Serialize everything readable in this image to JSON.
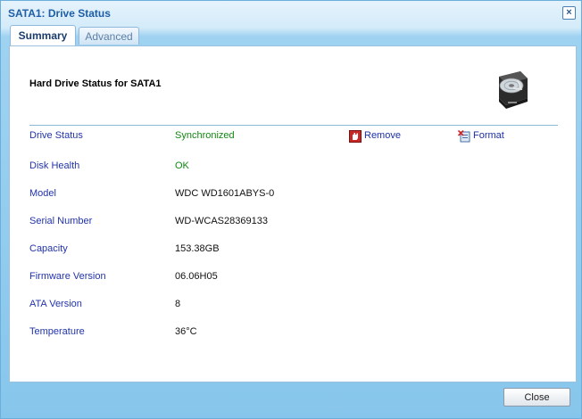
{
  "window": {
    "title": "SATA1: Drive Status",
    "close_glyph": "×"
  },
  "tabs": [
    {
      "label": "Summary",
      "active": true
    },
    {
      "label": "Advanced",
      "active": false
    }
  ],
  "panel": {
    "heading": "Hard Drive Status for SATA1",
    "icon": "hard-drive-icon"
  },
  "rows": [
    {
      "label": "Drive Status",
      "value": "Synchronized",
      "value_color": "#118811"
    },
    {
      "label": "Disk Health",
      "value": "OK",
      "value_color": "#118811"
    },
    {
      "label": "Model",
      "value": "WDC WD1601ABYS-0"
    },
    {
      "label": "Serial Number",
      "value": "WD-WCAS28369133"
    },
    {
      "label": "Capacity",
      "value": "153.38GB"
    },
    {
      "label": "Firmware Version",
      "value": "06.06H05"
    },
    {
      "label": "ATA Version",
      "value": "8"
    },
    {
      "label": "Temperature",
      "value": "36°C"
    }
  ],
  "actions": {
    "remove": {
      "label": "Remove",
      "icon": "remove-drive-icon"
    },
    "format": {
      "label": "Format",
      "icon": "format-drive-icon"
    }
  },
  "footer": {
    "close_label": "Close"
  },
  "colors": {
    "label": "#2233aa",
    "ok": "#118811",
    "title": "#1e5ea6",
    "link": "#1b2fa8"
  }
}
